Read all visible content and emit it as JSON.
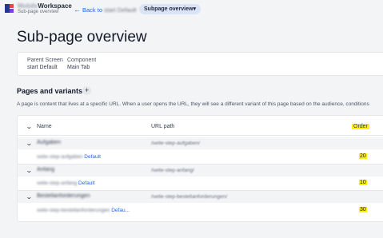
{
  "topbar": {
    "workspace_blurred": "Mobile",
    "workspace_label": "Workspace",
    "workspace_subtitle": "Sub-page overview",
    "back_prefix": "Back to",
    "back_blurred": "start Default",
    "pill_label": "Subpage overview",
    "pill_caret": "▾"
  },
  "page_title": "Sub-page overview",
  "info": {
    "parent_screen_label": "Parent Screen",
    "parent_screen_value": "start Default",
    "component_label": "Component",
    "component_value": "Main Tab"
  },
  "section": {
    "title": "Pages and variants",
    "add_glyph": "+",
    "description": "A page is content that lives at a specific URL. When a user opens the URL, they will see a different variant of this page based on the audience, conditions"
  },
  "table": {
    "headers": {
      "name": "Name",
      "url_path": "URL path",
      "order": "Order"
    },
    "rows": [
      {
        "name_blurred": "Aufgaben",
        "path_blurred": "/seite-step-aufgaben/",
        "variant_blurred": "seite-step-aufgaben",
        "variant_label": "Default",
        "order": "20"
      },
      {
        "name_blurred": "Anfang",
        "path_blurred": "/seite-step-anfang/",
        "variant_blurred": "seite-step-anfang",
        "variant_label": "Default",
        "order": "10"
      },
      {
        "name_blurred": "Bestellanforderungen",
        "path_blurred": "/seite-step-bestellanforderungen/",
        "variant_blurred": "seite-step-bestellanforderungen",
        "variant_label": "Defau...",
        "order": "30"
      }
    ]
  },
  "colors": {
    "accent": "#2563eb",
    "highlight": "#fff200",
    "background": "#f3f4f6"
  }
}
